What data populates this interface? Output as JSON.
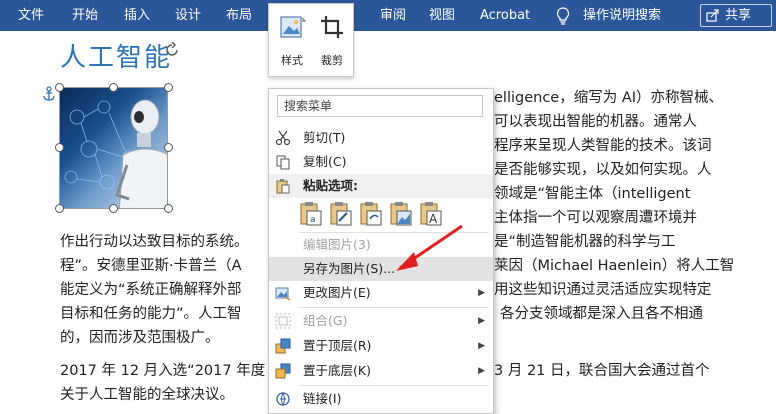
{
  "ribbon": {
    "tabs": [
      "文件",
      "开始",
      "插入",
      "设计",
      "布局",
      "",
      "",
      "审阅",
      "视图",
      "Acrobat",
      "",
      "操作说明搜索"
    ],
    "share_label": "共享",
    "bg_color": "#2b579a"
  },
  "mini_toolbar": {
    "style_label": "样式",
    "crop_label": "裁剪"
  },
  "document": {
    "heading": "人工智能",
    "lines": [
      "elligence，缩写为 AI）亦称智械、",
      "可以表现出智能的机器。通常人",
      "程序来呈现人类智能的技术。该词",
      "是否能够实现，以及如何实现。人",
      "领域是“智能主体（intelligent",
      "主体指一个可以观察周遭环境并",
      "作出行动以达致目标的系统。",
      "是“制造智能机器的科学与工",
      "程”。安德里亚斯·卡普兰（A",
      "莱因（Michael Haenlein）将人工智",
      "能定义为“系统正确解释外部",
      "用这些知识通过灵活适应实现特定",
      "目标和任务的能力”。人工智",
      "各分支领域都是深入且各不相通",
      "的，因而涉及范围极广。",
      "2017 年 12 月入选“2017 年度",
      "3 月 21 日，联合国大会通过首个",
      "关于人工智能的全球决议。"
    ]
  },
  "context_menu": {
    "search_placeholder": "搜索菜单",
    "items": {
      "cut": "剪切(T)",
      "copy": "复制(C)",
      "paste_options": "粘贴选项:",
      "edit_picture": "编辑图片(3)",
      "save_as_picture": "另存为图片(S)...",
      "change_picture": "更改图片(E)",
      "group": "组合(G)",
      "bring_to_front": "置于顶层(R)",
      "send_to_back": "置于底层(K)",
      "link": "链接(I)"
    }
  },
  "colors": {
    "accent": "#2b579a",
    "heading": "#2e74b5",
    "annotation_arrow": "#e02020"
  }
}
